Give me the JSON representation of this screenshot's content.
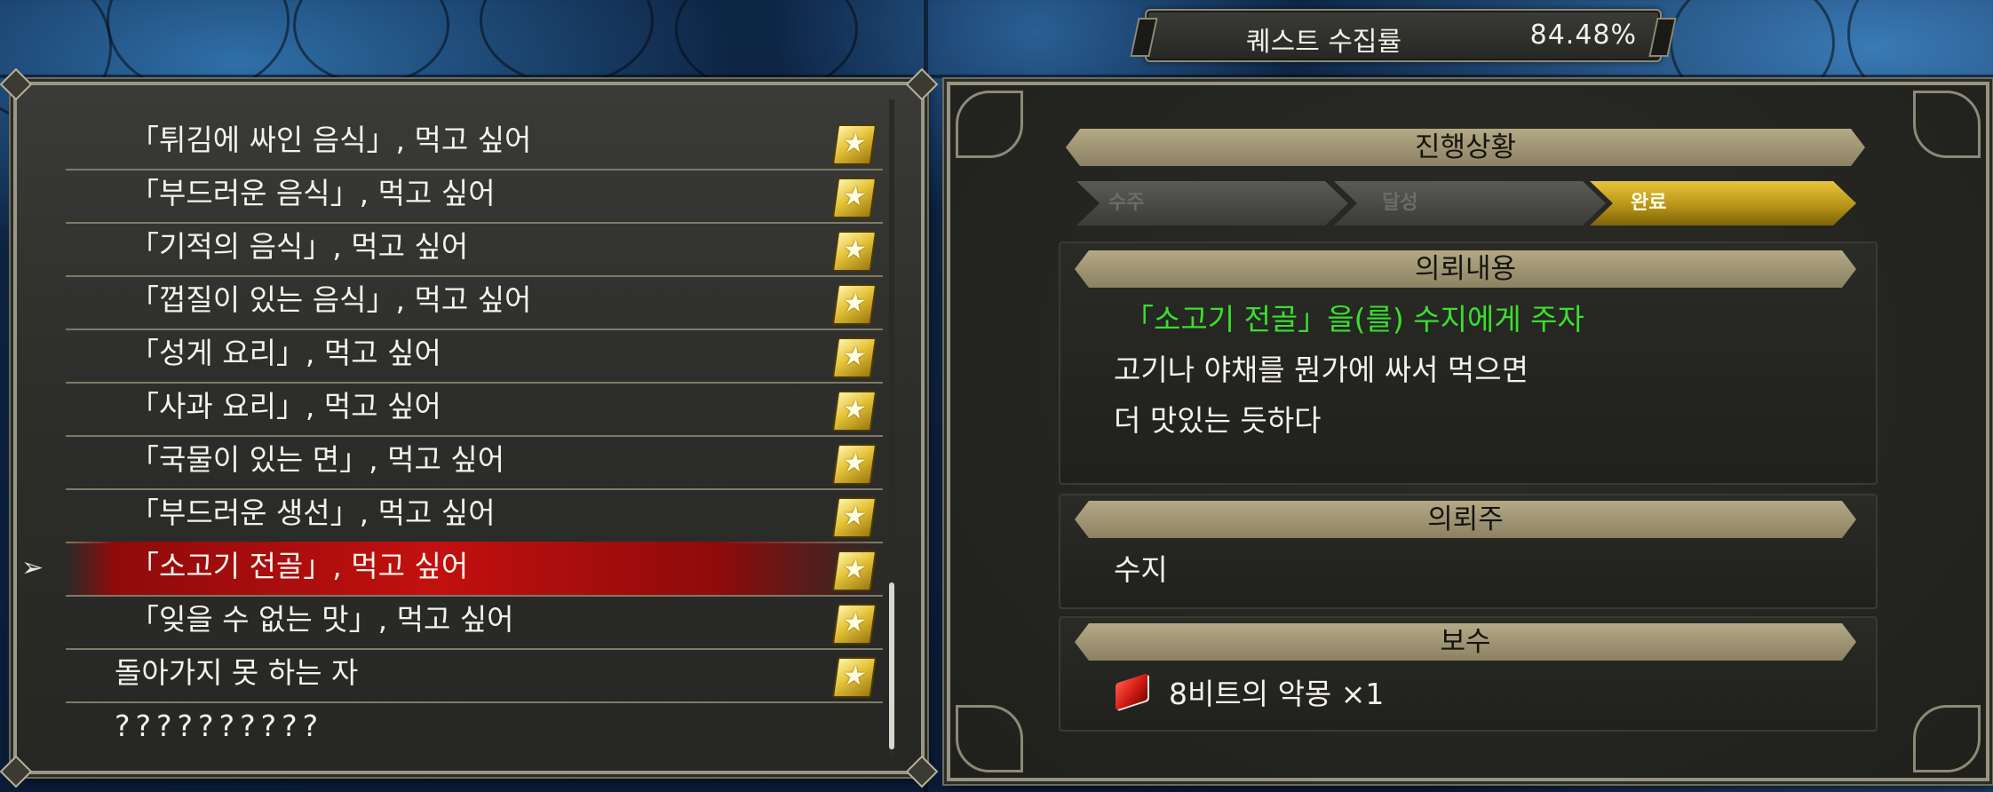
{
  "quest_rate": {
    "label": "퀘스트 수집률",
    "value": "84.48%"
  },
  "quest_list": [
    {
      "label": "「튀김에 싸인 음식」, 먹고 싶어",
      "completed": true
    },
    {
      "label": "「부드러운 음식」, 먹고 싶어",
      "completed": true
    },
    {
      "label": "「기적의 음식」, 먹고 싶어",
      "completed": true
    },
    {
      "label": "「껍질이 있는 음식」, 먹고 싶어",
      "completed": true
    },
    {
      "label": "「성게 요리」, 먹고 싶어",
      "completed": true
    },
    {
      "label": "「사과 요리」, 먹고 싶어",
      "completed": true
    },
    {
      "label": "「국물이 있는 면」, 먹고 싶어",
      "completed": true
    },
    {
      "label": "「부드러운 생선」, 먹고 싶어",
      "completed": true
    },
    {
      "label": "「소고기 전골」, 먹고 싶어",
      "completed": true,
      "selected": true
    },
    {
      "label": "「잊을 수 없는 맛」, 먹고 싶어",
      "completed": true
    },
    {
      "label": "돌아가지 못 하는 자",
      "completed": true
    },
    {
      "label": "??????????",
      "completed": false
    }
  ],
  "detail": {
    "progress_title": "진행상황",
    "progress_steps": [
      {
        "label": "수주",
        "active": false
      },
      {
        "label": "달성",
        "active": false
      },
      {
        "label": "완료",
        "active": true
      }
    ],
    "request_title": "의뢰내용",
    "request_objective": "「소고기 전골」을(를) 수지에게 주자",
    "request_desc_1": "고기나 야채를 뭔가에 싸서 먹으면",
    "request_desc_2": "더 맛있는 듯하다",
    "client_title": "의뢰주",
    "client_name": "수지",
    "reward_title": "보수",
    "reward_item": "8비트의 악몽 ×1",
    "reward_icon": "red-book-icon"
  },
  "colors": {
    "objective_green": "#39e02a",
    "selected_red": "#c2100f",
    "progress_gold": "#d4b02a"
  }
}
